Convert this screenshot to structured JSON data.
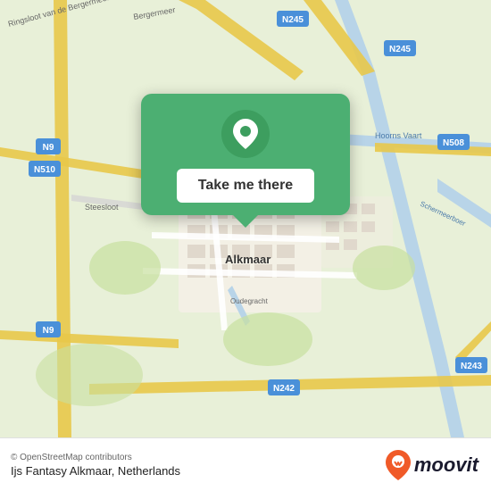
{
  "map": {
    "alt": "Map of Alkmaar, Netherlands"
  },
  "popup": {
    "button_label": "Take me there"
  },
  "footer": {
    "copyright": "© OpenStreetMap contributors",
    "location": "Ijs Fantasy Alkmaar, Netherlands"
  },
  "moovit": {
    "text": "moovit"
  },
  "colors": {
    "green": "#4caf72",
    "white": "#ffffff"
  }
}
